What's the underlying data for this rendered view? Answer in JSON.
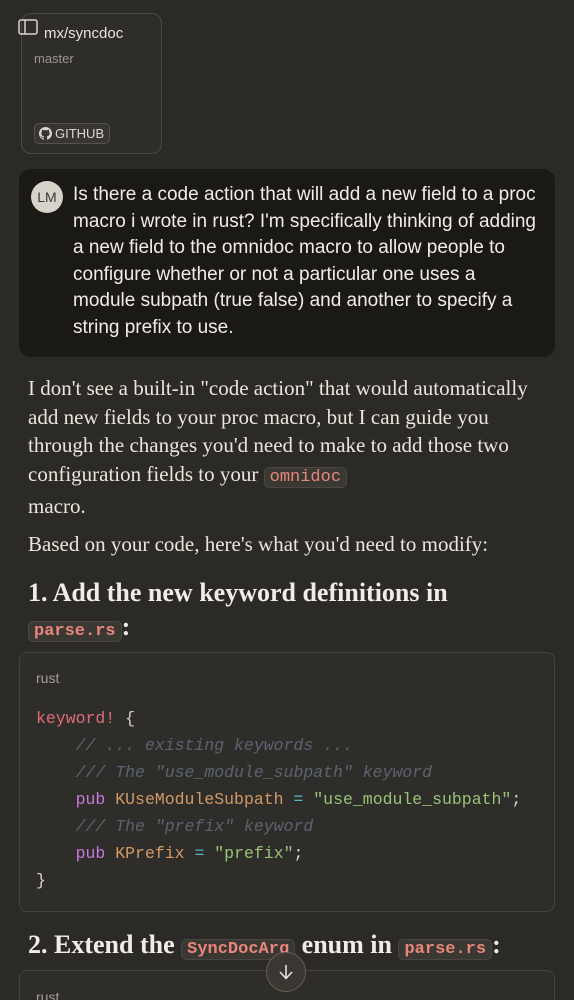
{
  "repo": {
    "name": "mx/syncdoc",
    "branch": "master",
    "badge_label": "GITHUB"
  },
  "user_message": {
    "avatar_initials": "LM",
    "text": "Is there a code action that will add a new field to a proc macro i wrote in rust? I'm specifically thinking of adding a new field to the omnidoc macro to allow people to configure whether or not a particular one uses a module subpath (true false) and another to specify a string prefix to use."
  },
  "response": {
    "para1_before": "I don't see a built-in \"code action\" that would automatically add new fields to your proc macro, but I can guide you through the changes you'd need to make to add those two configuration fields to your ",
    "para1_code": "omnidoc",
    "para1_after": " macro.",
    "para2": "Based on your code, here's what you'd need to modify:",
    "heading1_text": "1. Add the new keyword definitions in ",
    "heading1_code": "parse.rs",
    "heading1_suffix": ":",
    "code1": {
      "language": "rust",
      "lines": [
        "keyword! {",
        "    // ... existing keywords ...",
        "    /// The \"use_module_subpath\" keyword",
        "    pub KUseModuleSubpath = \"use_module_subpath\";",
        "    /// The \"prefix\" keyword",
        "    pub KPrefix = \"prefix\";",
        "}"
      ]
    },
    "heading2_text": "2. Extend the ",
    "heading2_code1": "SyncDocArg",
    "heading2_mid": " enum in ",
    "heading2_code2": "parse.rs",
    "heading2_suffix": ":",
    "code2": {
      "language": "rust"
    }
  },
  "colors": {
    "background": "#2b2a27",
    "user_bubble": "#1a1916",
    "inline_code": "#e9867c"
  },
  "icons": {
    "sidebar": "sidebar-toggle-icon",
    "github": "github-icon",
    "scroll": "arrow-down-icon"
  }
}
